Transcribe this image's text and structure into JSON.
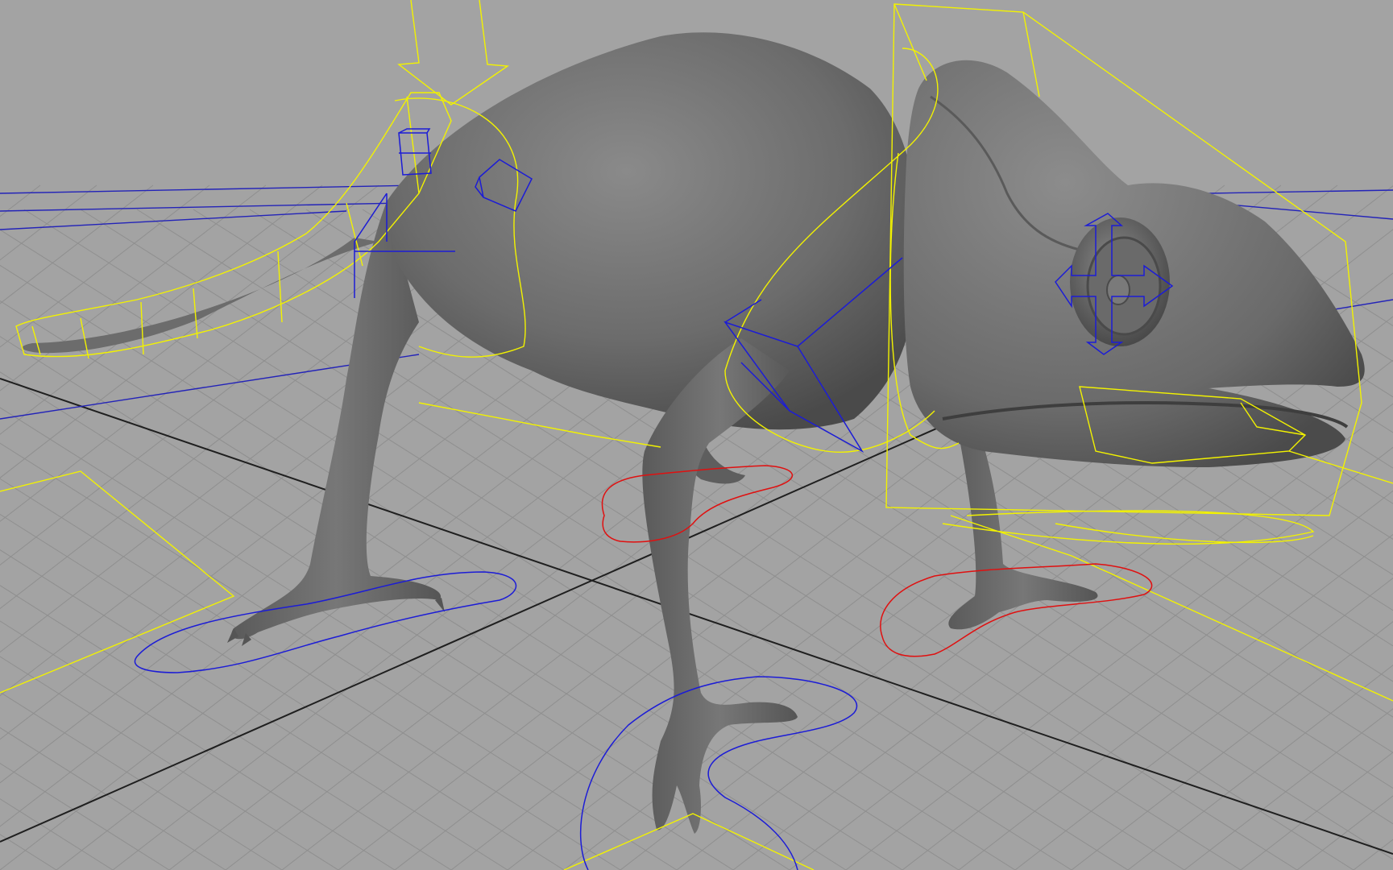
{
  "viewport": {
    "colors": {
      "background": "#a3a3a3",
      "grid_minor": "#8f8f8f",
      "grid_major": "#1f1f1f",
      "mesh": "#6e6e6e",
      "rig_yellow": "#f2f200",
      "rig_blue": "#1c1cd6",
      "rig_red": "#e01010"
    }
  }
}
